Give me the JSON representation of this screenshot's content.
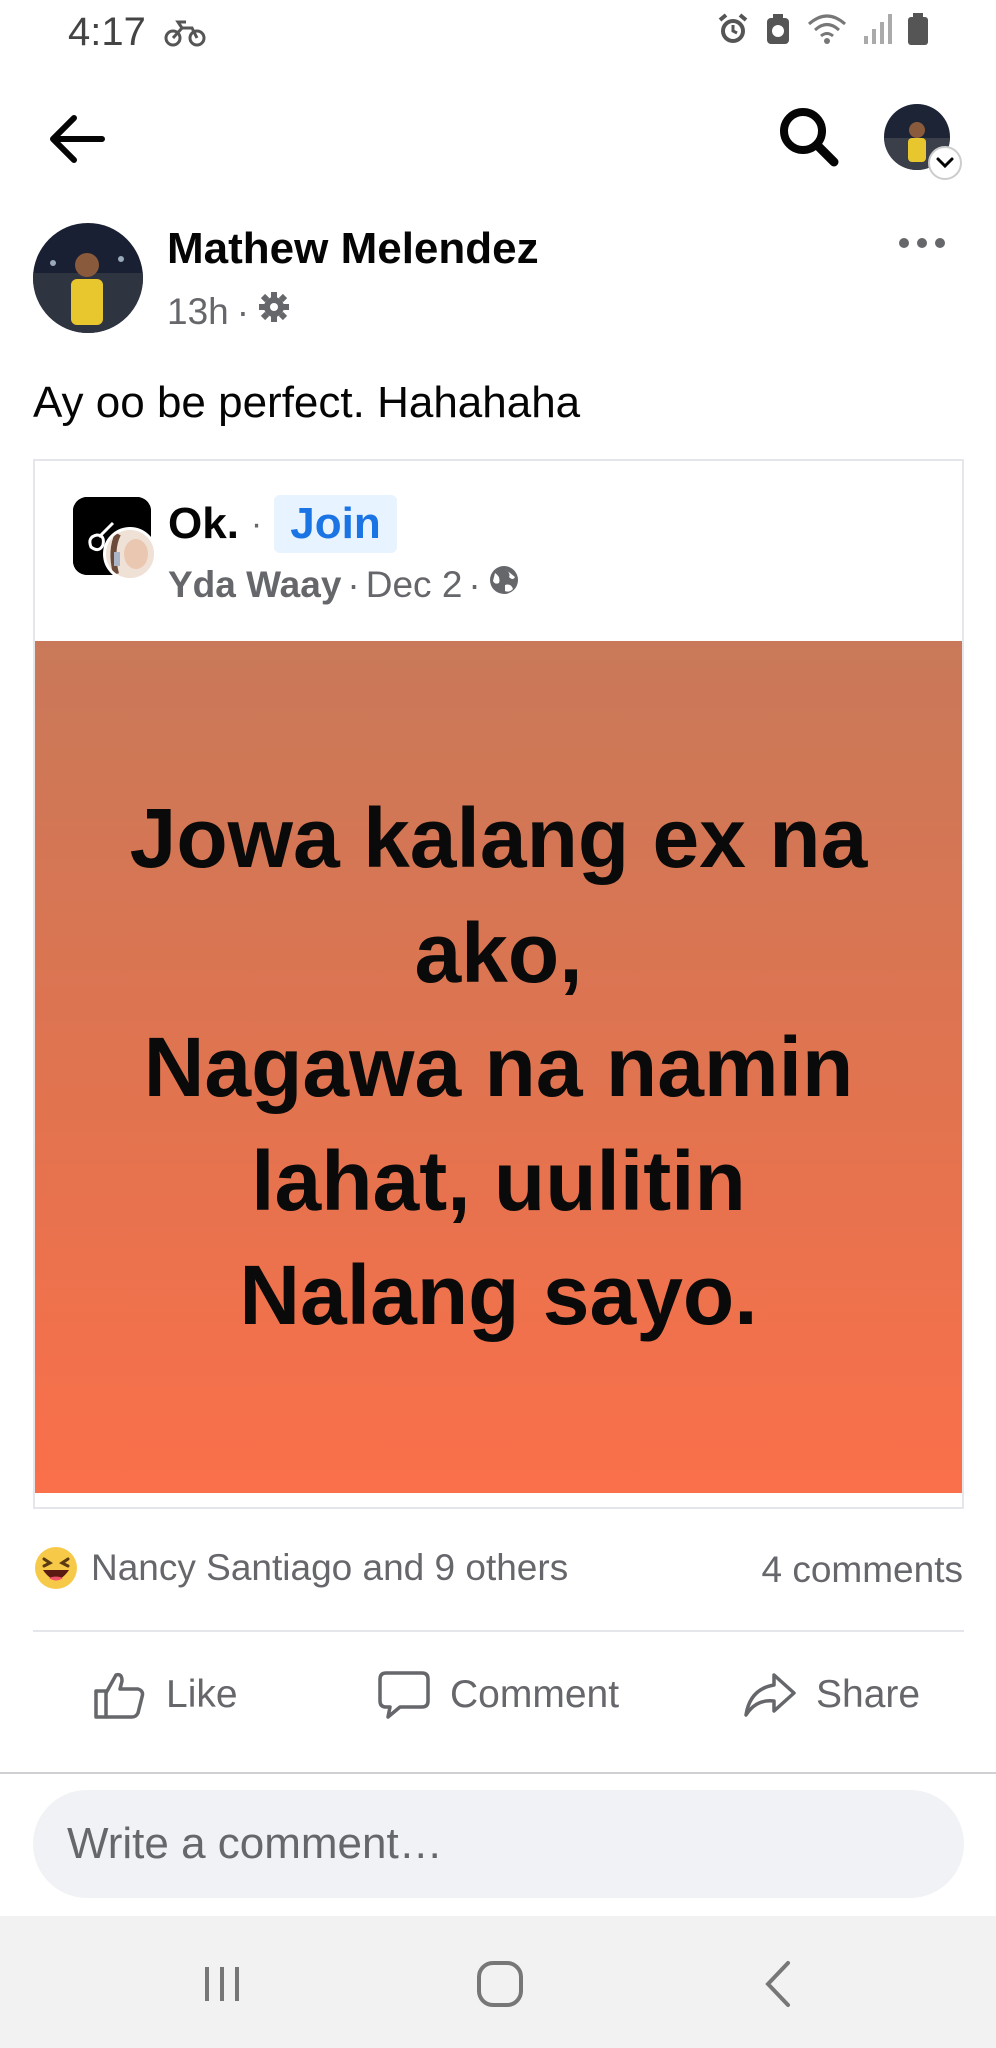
{
  "status_bar": {
    "time": "4:17"
  },
  "icons": {
    "back": "arrow-left-icon",
    "search": "search-icon",
    "profile": "profile-avatar",
    "more": "more-horizontal-icon",
    "privacy": "gear-icon",
    "public": "globe-icon",
    "reaction": "haha-emoji-icon",
    "like": "thumbs-up-icon",
    "comment": "comment-bubble-icon",
    "share": "share-arrow-icon"
  },
  "post": {
    "author": "Mathew Melendez",
    "time": "13h",
    "meta_separator": "·",
    "text": "Ay oo be perfect. Hahahaha"
  },
  "shared_post": {
    "group_name": "Ok.",
    "separator": "·",
    "join_label": "Join",
    "poster": "Yda Waay",
    "date": "Dec 2",
    "image_text": "Jowa kalang ex na\nako,\nNagawa na namin\nlahat, uulitin\nNalang sayo."
  },
  "reactions": {
    "text": "Nancy Santiago and 9 others",
    "comments": "4 comments"
  },
  "actions": {
    "like": "Like",
    "comment": "Comment",
    "share": "Share"
  },
  "comment_box": {
    "placeholder": "Write a comment…"
  },
  "colors": {
    "accent": "#1b74e4",
    "join_bg": "#e7f3ff",
    "meme_top": "#c97959",
    "meme_bottom": "#fa704a"
  }
}
